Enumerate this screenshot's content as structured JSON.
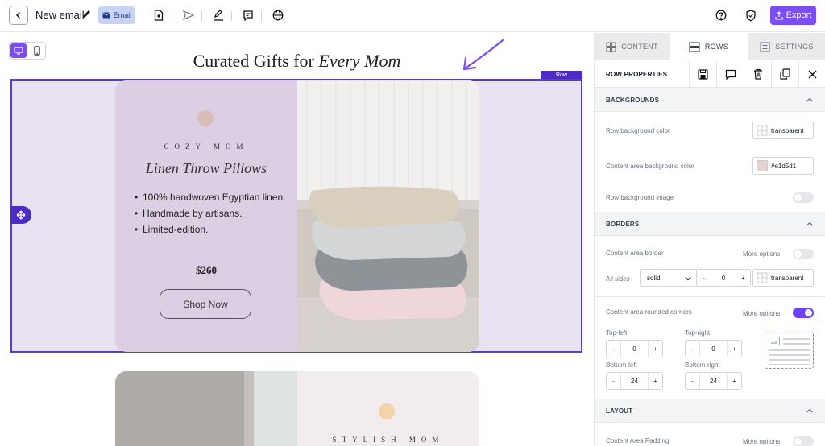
{
  "topbar": {
    "title": "New email",
    "badge": "Email",
    "export_label": "Export"
  },
  "canvas": {
    "headline_plain": "Curated Gifts for ",
    "headline_italic": "Every Mom",
    "row_tag": "Row",
    "product": {
      "brand": "COZY MOM",
      "name": "Linen Throw Pillows",
      "bullets": [
        "100% handwoven Egyptian linen.",
        "Handmade by artisans.",
        "Limited-edition."
      ],
      "price": "$260",
      "button": "Shop Now"
    },
    "product2": {
      "brand": "STYLISH MOM"
    }
  },
  "panel": {
    "tabs": {
      "content": "CONTENT",
      "rows": "ROWS",
      "settings": "SETTINGS"
    },
    "props_title": "ROW PROPERTIES",
    "backgrounds": {
      "header": "BACKGROUNDS",
      "row_bg_label": "Row background color",
      "row_bg_value": "transparent",
      "content_bg_label": "Content area background color",
      "content_bg_value": "#e1d5d1",
      "row_bg_image_label": "Row background image"
    },
    "borders": {
      "header": "BORDERS",
      "content_border_label": "Content area border",
      "more_options": "More options",
      "all_sides_label": "All sides",
      "style_value": "solid",
      "width_value": "0",
      "color_value": "transparent",
      "rounded_label": "Content area rounded corners",
      "more_options_2": "More options",
      "top_left_label": "Top-left",
      "top_left_value": "0",
      "top_right_label": "Top-right",
      "top_right_value": "0",
      "bottom_left_label": "Bottom-left",
      "bottom_left_value": "24",
      "bottom_right_label": "Bottom-right",
      "bottom_right_value": "24"
    },
    "layout": {
      "header": "LAYOUT",
      "padding_label": "Content Area Padding",
      "more_options": "More options"
    },
    "stepper_minus": "-",
    "stepper_plus": "+"
  },
  "colors": {
    "accent": "#7b4df5",
    "selection": "#4c2bc6",
    "card_bg": "#dccfe3",
    "content_bg": "#e1d5d1"
  }
}
